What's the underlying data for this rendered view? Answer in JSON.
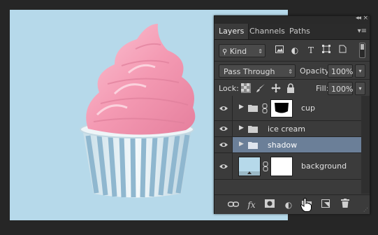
{
  "panel": {
    "tabs": [
      {
        "label": "Layers",
        "active": true
      },
      {
        "label": "Channels",
        "active": false
      },
      {
        "label": "Paths",
        "active": false
      }
    ],
    "collapse_icon": "double-chevron-icon",
    "close_icon": "close-icon",
    "menu_icon": "panel-menu-icon"
  },
  "filter": {
    "kind_label": "Kind",
    "icons": [
      "pixel-layer-filter-icon",
      "adjustment-filter-icon",
      "type-filter-icon",
      "shape-filter-icon",
      "smart-object-filter-icon"
    ],
    "type_glyph": "T"
  },
  "blend": {
    "mode": "Pass Through",
    "opacity_label": "Opacity:",
    "opacity_value": "100%"
  },
  "lock": {
    "label": "Lock:",
    "fill_label": "Fill:",
    "fill_value": "100%"
  },
  "layers": [
    {
      "name": "cup",
      "kind": "group",
      "expanded": false,
      "has_mask": true,
      "visible": true,
      "selected": false
    },
    {
      "name": "ice cream",
      "kind": "group",
      "expanded": false,
      "visible": true,
      "selected": false
    },
    {
      "name": "shadow",
      "kind": "group",
      "expanded": false,
      "visible": true,
      "selected": true
    },
    {
      "name": "background",
      "kind": "layer",
      "has_mask": true,
      "visible": true,
      "selected": false
    }
  ],
  "bottom_bar": {
    "icons": [
      "link-layers-icon",
      "fx-icon",
      "add-mask-icon",
      "adjustment-layer-icon",
      "new-group-icon",
      "new-layer-icon",
      "trash-icon"
    ],
    "fx_label": "fx"
  },
  "colors": {
    "canvas_bg": "#b6d9ea",
    "panel_bg": "#3b3b3b",
    "selected_row": "#6b7f98",
    "ice_cream": "#f7a6bd",
    "cup_stripe": "#8fb7cf"
  }
}
